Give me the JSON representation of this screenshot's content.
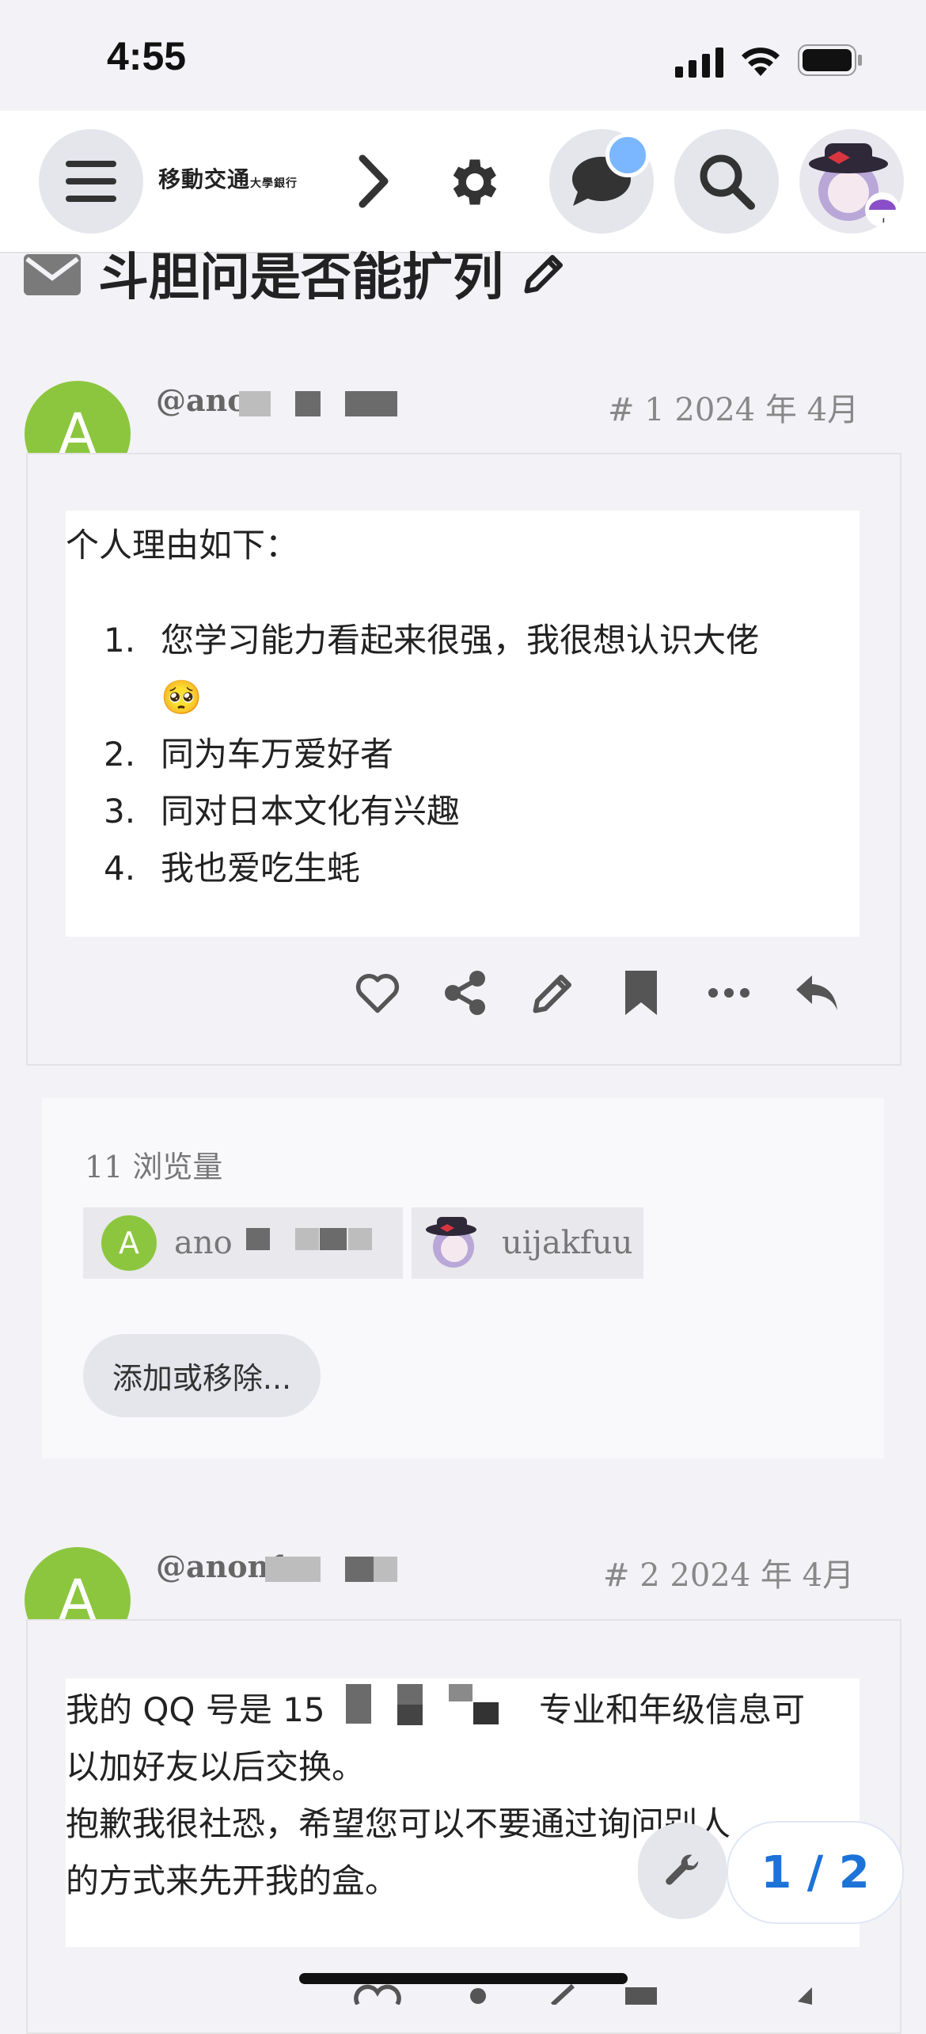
{
  "status_bar": {
    "time": "4:55"
  },
  "header": {
    "logo_main": "移動交通",
    "logo_sub": "大學銀行",
    "notification_dot_color": "#7ab7ff"
  },
  "topic": {
    "title": "斗胆问是否能扩列"
  },
  "posts": [
    {
      "avatar_letter": "A",
      "username": "@anon",
      "post_number": "# 1",
      "date": "2024 年 4月",
      "intro": "个人理由如下：",
      "list": [
        {
          "num": "1.",
          "text": "您学习能力看起来很强，我很想认识大佬",
          "emoji": "🥺"
        },
        {
          "num": "2.",
          "text": "同为车万爱好者"
        },
        {
          "num": "3.",
          "text": "同对日本文化有兴趣"
        },
        {
          "num": "4.",
          "text": "我也爱吃生蚝"
        }
      ]
    },
    {
      "avatar_letter": "A",
      "username": "@anon1",
      "post_number": "# 2",
      "date": "2024 年 4月",
      "line1_a": "我的 QQ 号是 15",
      "line1_b": "专业和年级信息可",
      "line2": "以加好友以后交换。",
      "line3": "抱歉我很社恐，希望您可以不要通过询问别人",
      "line4": "的方式来先开我的盒。"
    }
  ],
  "views": {
    "count_label": "11 浏览量",
    "chips": [
      {
        "avatar_letter": "A",
        "name": "ano"
      },
      {
        "name": "uijakfuu"
      }
    ],
    "add_remove_label": "添加或移除..."
  },
  "pagination": {
    "label": "1 / 2"
  }
}
